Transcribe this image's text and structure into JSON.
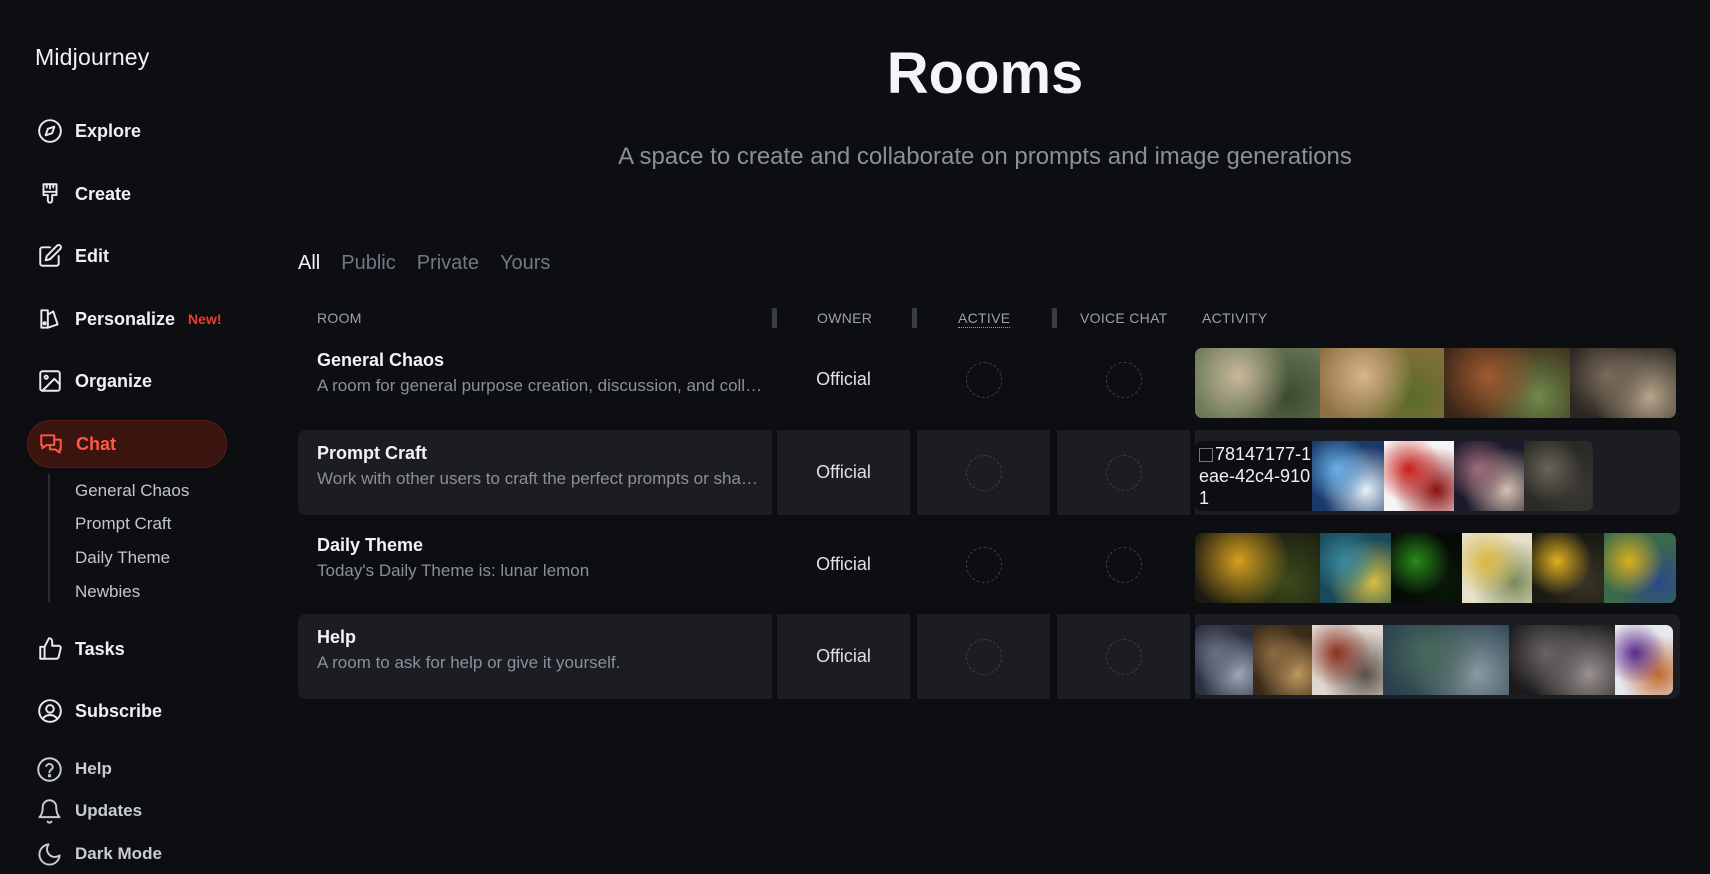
{
  "app": {
    "brand": "Midjourney"
  },
  "sidebar": {
    "items": [
      {
        "label": "Explore",
        "icon": "compass-icon"
      },
      {
        "label": "Create",
        "icon": "paintbrush-icon"
      },
      {
        "label": "Edit",
        "icon": "edit-icon"
      },
      {
        "label": "Personalize",
        "icon": "personalize-icon",
        "badge": "New!"
      },
      {
        "label": "Organize",
        "icon": "image-icon"
      },
      {
        "label": "Chat",
        "icon": "chat-icon",
        "active": true
      }
    ],
    "chat_rooms": [
      "General Chaos",
      "Prompt Craft",
      "Daily Theme",
      "Newbies"
    ],
    "lower_items": [
      {
        "label": "Tasks",
        "icon": "thumbs-up-icon"
      },
      {
        "label": "Subscribe",
        "icon": "user-circle-icon"
      }
    ],
    "footer_items": [
      {
        "label": "Help",
        "icon": "help-icon"
      },
      {
        "label": "Updates",
        "icon": "bell-icon"
      },
      {
        "label": "Dark Mode",
        "icon": "moon-icon"
      }
    ]
  },
  "page": {
    "title": "Rooms",
    "subtitle": "A space to create and collaborate on prompts and image generations"
  },
  "filters": {
    "tabs": [
      "All",
      "Public",
      "Private",
      "Yours"
    ],
    "active": "All"
  },
  "table": {
    "columns": [
      "ROOM",
      "OWNER",
      "ACTIVE",
      "VOICE CHAT",
      "ACTIVITY"
    ],
    "rows": [
      {
        "name": "General Chaos",
        "description": "A room for general purpose creation, discussion, and collaboration",
        "owner": "Official",
        "activity_thumbs": [
          {
            "colors": [
              "#6b7a5a",
              "#c9b79a",
              "#3d4a2e"
            ]
          },
          {
            "colors": [
              "#8c7040",
              "#d9b58a",
              "#5a6b2a"
            ]
          },
          {
            "colors": [
              "#3a2618",
              "#a05a30",
              "#6e8a4a"
            ]
          },
          {
            "colors": [
              "#2a2622",
              "#7a6a5a",
              "#b8a48a"
            ]
          }
        ]
      },
      {
        "name": "Prompt Craft",
        "description": "Work with other users to craft the perfect prompts or share your own",
        "owner": "Official",
        "broken_image_alt": "78147177-1eae-42c4-9101",
        "activity_thumbs": [
          {
            "colors": [
              "#1a3a6a",
              "#6ab0e8",
              "#e8f2fa"
            ]
          },
          {
            "colors": [
              "#f5f5f5",
              "#c81e1a",
              "#8a1010"
            ]
          },
          {
            "colors": [
              "#1a1a2a",
              "#a06a7a",
              "#d8c0b0"
            ]
          },
          {
            "colors": [
              "#2a2a26",
              "#6a6458",
              "#3a3832"
            ]
          }
        ]
      },
      {
        "name": "Daily Theme",
        "description": "Today's Daily Theme is: lunar lemon",
        "owner": "Official",
        "activity_thumbs": [
          {
            "colors": [
              "#1a1a10",
              "#d8a020",
              "#3a4a1a"
            ]
          },
          {
            "colors": [
              "#1a4a5a",
              "#3a8aa0",
              "#d8c040"
            ]
          },
          {
            "colors": [
              "#050a05",
              "#2a8a1a",
              "#0a1a0a"
            ]
          },
          {
            "colors": [
              "#e8e0c8",
              "#d8b840",
              "#7a8a5a"
            ]
          },
          {
            "colors": [
              "#1a1a14",
              "#e0b020",
              "#3a3426"
            ]
          },
          {
            "colors": [
              "#3a6a4a",
              "#d8b020",
              "#2a4a8a"
            ]
          }
        ]
      },
      {
        "name": "Help",
        "description": "A room to ask for help or give it yourself.",
        "owner": "Official",
        "activity_thumbs": [
          {
            "colors": [
              "#2a3040",
              "#6a7080",
              "#a0a8b8"
            ]
          },
          {
            "colors": [
              "#3a2a18",
              "#8a6a40",
              "#c09860"
            ]
          },
          {
            "colors": [
              "#e0d8d0",
              "#8a3020",
              "#5a5048"
            ]
          },
          {
            "colors": [
              "#2a4050",
              "#4a6a5a",
              "#8a9aa0"
            ]
          },
          {
            "colors": [
              "#1a1a1a",
              "#6a6464",
              "#9a9090"
            ]
          },
          {
            "colors": [
              "#e8e8f0",
              "#5a2a8a",
              "#c06a30"
            ]
          }
        ]
      }
    ]
  }
}
